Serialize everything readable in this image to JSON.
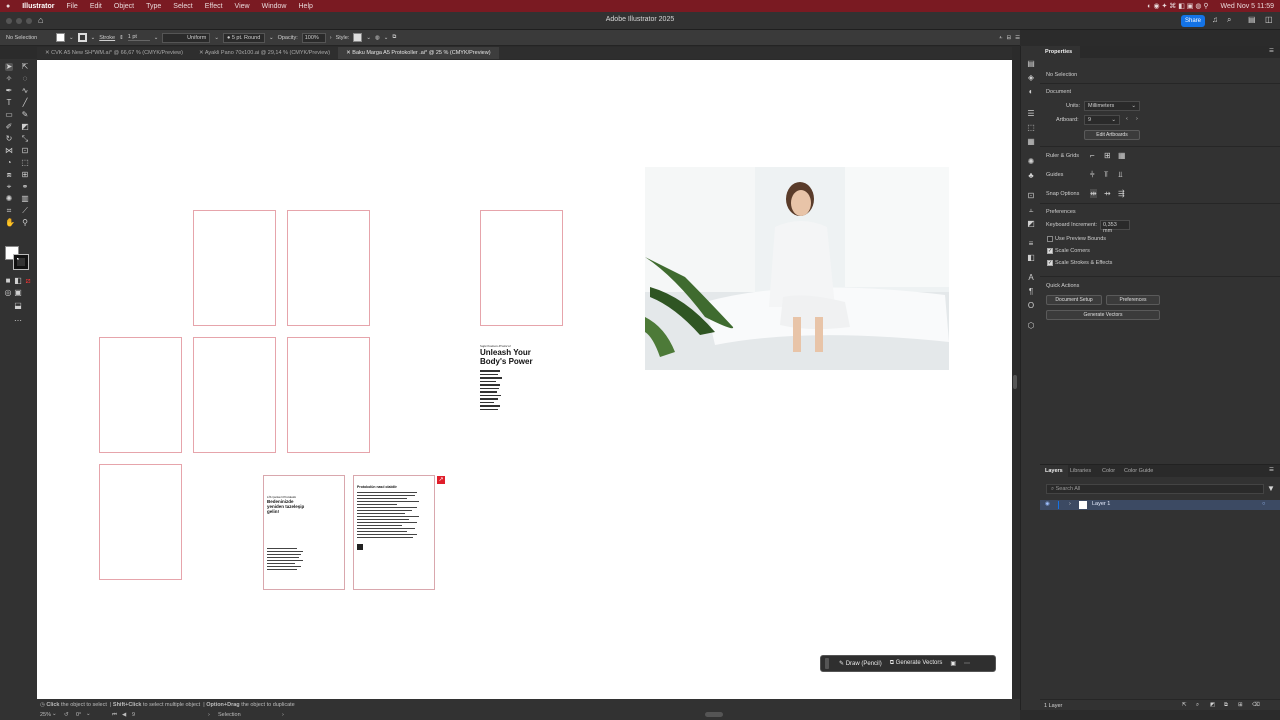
{
  "menubar": {
    "app": "Illustrator",
    "items": [
      "File",
      "Edit",
      "Object",
      "Type",
      "Select",
      "Effect",
      "View",
      "Window",
      "Help"
    ],
    "clock": "Wed Nov 5  11:59"
  },
  "titlebar": {
    "title": "Adobe Illustrator 2025",
    "share": "Share"
  },
  "control": {
    "selection": "No Selection",
    "stroke_label": "Stroke",
    "stroke_weight": "1 pt",
    "profile": "Uniform",
    "brush": "5 pt. Round",
    "opacity_label": "Opacity:",
    "opacity_value": "100%",
    "style_label": "Style:"
  },
  "tabs": [
    {
      "label": "CVK A5 New SH*WM.ai* @ 66,67 % (CMYK/Preview)",
      "active": false
    },
    {
      "label": "Ayakli Pano 70x100.ai @ 29,14 % (CMYK/Preview)",
      "active": false
    },
    {
      "label": "Baku Marga A5 Protokoller .ai* @ 25 % (CMYK/Preview)",
      "active": true
    }
  ],
  "artboard_doc1": {
    "eyebrow": "Superhuman Protocol",
    "headline": "Unleash Your Body's Power"
  },
  "artboard_doc2": {
    "eyebrow": "LİS Çerkezi Protokolü",
    "headline": "Bedeninizde yeniden tazeleşip gelin!"
  },
  "artboard_doc3": {
    "eyebrow": "Protokolün nasıl olabilir"
  },
  "properties": {
    "tab": "Properties",
    "no_selection": "No Selection",
    "document": "Document",
    "units_label": "Units:",
    "units_value": "Millimeters",
    "artboard_label": "Artboard:",
    "artboard_value": "9",
    "edit_artboards": "Edit Artboards",
    "ruler_grids": "Ruler & Grids",
    "guides": "Guides",
    "snap_options": "Snap Options",
    "preferences": "Preferences",
    "keyboard_increment_label": "Keyboard Increment:",
    "keyboard_increment_value": "0,353 mm",
    "use_preview_bounds": "Use Preview Bounds",
    "scale_corners": "Scale Corners",
    "scale_strokes": "Scale Strokes & Effects",
    "quick_actions": "Quick Actions",
    "document_setup": "Document Setup",
    "preferences_btn": "Preferences",
    "generate_vectors": "Generate Vectors"
  },
  "layers": {
    "tabs": [
      "Layers",
      "Libraries",
      "Color",
      "Color Guide"
    ],
    "search_placeholder": "Search All",
    "layer1": "Layer 1",
    "count": "1 Layer"
  },
  "floating": {
    "draw": "Draw (Pencil)",
    "generate": "Generate Vectors"
  },
  "status": {
    "hint1_bold": "Click",
    "hint1": " the object to select",
    "hint2_bold": "Shift+Click",
    "hint2": " to select multiple object",
    "hint3_bold": "Option+Drag",
    "hint3": " the object to duplicate",
    "zoom": "25%",
    "rotation": "0°",
    "artboard": "9",
    "tool": "Selection"
  },
  "colors": {
    "menubar": "#7a1a22",
    "accent": "#1473e6",
    "artboard_border": "#e6a4ab"
  }
}
